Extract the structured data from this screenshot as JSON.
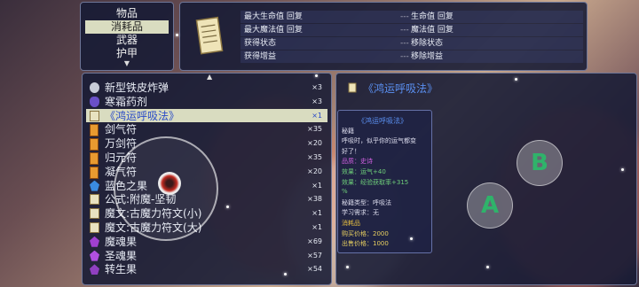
{
  "categories": [
    {
      "label": "物品",
      "selected": false
    },
    {
      "label": "消耗品",
      "selected": true
    },
    {
      "label": "武器",
      "selected": false
    },
    {
      "label": "护甲",
      "selected": false
    }
  ],
  "effects": [
    {
      "a": "最大生命值 回复",
      "b": "生命值 回复"
    },
    {
      "a": "最大魔法值 回复",
      "b": "魔法值 回复"
    },
    {
      "a": "获得状态",
      "b": "移除状态"
    },
    {
      "a": "获得增益",
      "b": "移除增益"
    }
  ],
  "effect_dash": "---",
  "items": [
    {
      "name": "新型铁皮炸弹",
      "count": "×3",
      "icon": "bomb-icon",
      "color": "#c8ccd8"
    },
    {
      "name": "寒霜药剂",
      "count": "×3",
      "icon": "potion-icon",
      "color": "#6a50c8"
    },
    {
      "name": "《鸿运呼吸法》",
      "count": "×1",
      "icon": "scroll-icon",
      "color": "#e8e2c0",
      "selected": true
    },
    {
      "name": "剑气符",
      "count": "×35",
      "icon": "talisman-icon",
      "color": "#e89a30"
    },
    {
      "name": "万剑符",
      "count": "×20",
      "icon": "talisman-icon",
      "color": "#e89a30"
    },
    {
      "name": "归元符",
      "count": "×35",
      "icon": "talisman-icon",
      "color": "#e89a30"
    },
    {
      "name": "凝气符",
      "count": "×20",
      "icon": "talisman-icon",
      "color": "#e89a30"
    },
    {
      "name": "蓝色之果",
      "count": "×1",
      "icon": "fruit-icon",
      "color": "#3a8ae0"
    },
    {
      "name": "公式:附魔-坚韧",
      "count": "×38",
      "icon": "scroll-icon",
      "color": "#e8e2c0"
    },
    {
      "name": "魔文:古魔力符文(小)",
      "count": "×1",
      "icon": "scroll-icon",
      "color": "#e8e2c0"
    },
    {
      "name": "魔文:古魔力符文(大)",
      "count": "×1",
      "icon": "scroll-icon",
      "color": "#e8e2c0"
    },
    {
      "name": "魔魂果",
      "count": "×69",
      "icon": "fruit-icon",
      "color": "#a040d0"
    },
    {
      "name": "圣魂果",
      "count": "×57",
      "icon": "fruit-icon",
      "color": "#b050e0"
    },
    {
      "name": "转生果",
      "count": "×54",
      "icon": "fruit-icon",
      "color": "#9040c0"
    }
  ],
  "detail": {
    "title": "《鸿运呼吸法》"
  },
  "tooltip": [
    {
      "text": "《鸿运呼吸法》",
      "color": "#5a8ff0"
    },
    {
      "text": "秘籍",
      "color": "#dde"
    },
    {
      "text": "呼吸时，似乎你的运气都变",
      "color": "#dde"
    },
    {
      "text": "好了！",
      "color": "#dde"
    },
    {
      "text": "品质：史诗",
      "color": "#d060e0"
    },
    {
      "text": "效果：运气+40",
      "color": "#6fd07a"
    },
    {
      "text": "效果：经验获取率+315",
      "color": "#6fd07a"
    },
    {
      "text": "%",
      "color": "#6fd07a"
    },
    {
      "text": "秘籍类型：呼吸法",
      "color": "#dde"
    },
    {
      "text": "学习需求：无",
      "color": "#dde"
    },
    {
      "text": "消耗品",
      "color": "#e8c040"
    },
    {
      "text": "购买价格：2000",
      "color": "#e8d060"
    },
    {
      "text": "出售价格：1000",
      "color": "#e8d060"
    }
  ],
  "buttons": {
    "a": "A",
    "b": "B"
  }
}
